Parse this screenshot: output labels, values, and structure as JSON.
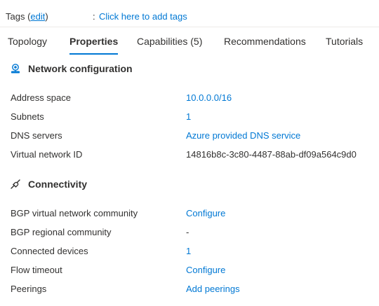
{
  "tags": {
    "label_prefix": "Tags (",
    "edit_link": "edit",
    "label_suffix": ")",
    "separator": ":",
    "add_link": "Click here to add tags"
  },
  "tabs": [
    {
      "label": "Topology",
      "active": false
    },
    {
      "label": "Properties",
      "active": true
    },
    {
      "label": "Capabilities (5)",
      "active": false
    },
    {
      "label": "Recommendations",
      "active": false
    },
    {
      "label": "Tutorials",
      "active": false
    }
  ],
  "network_configuration": {
    "title": "Network configuration",
    "icon": "network-config-icon",
    "rows": [
      {
        "label": "Address space",
        "value": "10.0.0.0/16",
        "link": true
      },
      {
        "label": "Subnets",
        "value": "1",
        "link": true
      },
      {
        "label": "DNS servers",
        "value": "Azure provided DNS service",
        "link": true
      },
      {
        "label": "Virtual network ID",
        "value": "14816b8c-3c80-4487-88ab-df09a564c9d0",
        "link": false
      }
    ]
  },
  "connectivity": {
    "title": "Connectivity",
    "icon": "connectivity-icon",
    "rows": [
      {
        "label": "BGP virtual network community",
        "value": "Configure",
        "link": true
      },
      {
        "label": "BGP regional community",
        "value": "-",
        "link": false
      },
      {
        "label": "Connected devices",
        "value": "1",
        "link": true
      },
      {
        "label": "Flow timeout",
        "value": "Configure",
        "link": true
      },
      {
        "label": "Peerings",
        "value": "Add peerings",
        "link": true
      }
    ]
  },
  "colors": {
    "link": "#0078d4",
    "text": "#323130",
    "accent": "#0078d4"
  }
}
